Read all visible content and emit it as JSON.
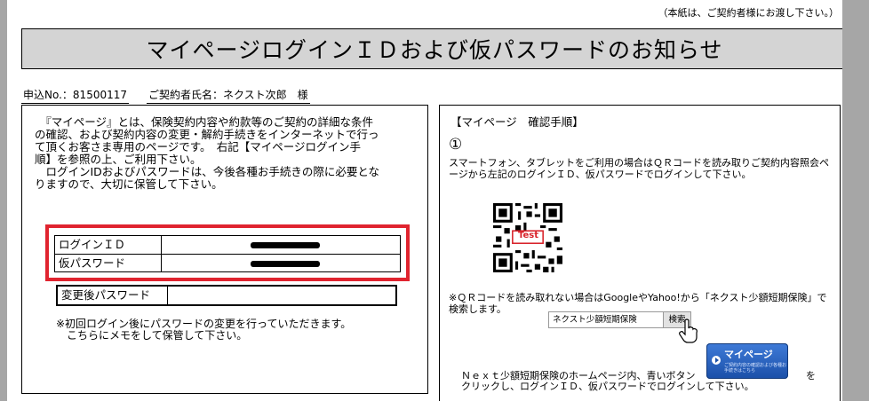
{
  "note": "（本紙は、ご契約者様にお渡し下さい。）",
  "title": "マイページログインＩＤおよび仮パスワードのお知らせ",
  "info": {
    "application_no": "申込No.：81500117",
    "contractor": "ご契約者氏名：ネクスト次郎　様"
  },
  "left": {
    "intro": "　『マイページ』とは、保険契約内容や約款等のご契約の詳細な条件\nの確認、および契約内容の変更・解約手続きをインターネットで行っ\nて頂くお客さま専用のページです。　右記【マイページログイン手\n順】を参照の上、ご利用下さい。\n　ログインIDおよびパスワードは、今後各種お手続きの際に必要とな\nりますので、大切に保管して下さい。",
    "login_id_label": "ログインＩＤ",
    "temp_password_label": "仮パスワード",
    "changed_password_label": "変更後パスワード",
    "memo": "※初回ログイン後にパスワードの変更を行っていただきます。\n　こちらにメモをして保管して下さい。"
  },
  "right": {
    "heading": "【マイページ　確認手順】",
    "step": "①",
    "text1": "スマートフォン、タブレットをご利用の場合はＱＲコードを読み取りご契約内容照会ページから左記のログインＩＤ、仮パスワードでログインして下さい。",
    "qr_label": "Test",
    "text2": "※ＱＲコードを読み取れない場合はGoogleやYahoo!から「ネクスト少額短期保険」で検索します。",
    "search_value": "ネクスト少額短期保険",
    "search_button": "検索",
    "mypage_button": "マイページ",
    "mypage_button_sub": "ご契約内容の確認および各種お手続きはこちら",
    "bottom_line1a": "Ｎｅｘｔ少額短期保険のホームページ内、青いボタン",
    "bottom_line1b": "を",
    "bottom_line2": "クリックし、ログインＩＤ、仮パスワードでログインして下さい。"
  },
  "colors": {
    "accent_red": "#e0242f",
    "title_bg": "#d4d4d4",
    "button_blue": "#1a4fa8"
  }
}
